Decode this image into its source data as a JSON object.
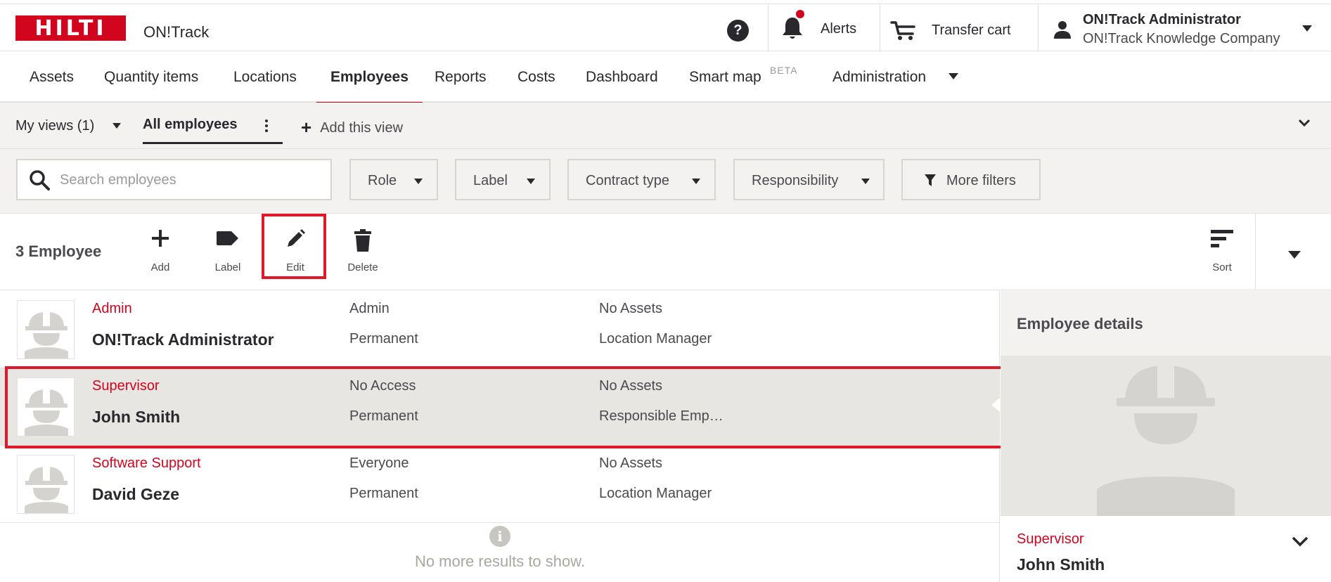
{
  "header": {
    "logo_text": "HILTI",
    "app_name": "ON!Track",
    "help_label": "?",
    "alerts_label": "Alerts",
    "transfer_cart_label": "Transfer cart",
    "user_name": "ON!Track Administrator",
    "user_company": "ON!Track Knowledge Company",
    "brand_color": "#d2051e"
  },
  "nav": {
    "items": [
      {
        "label": "Assets"
      },
      {
        "label": "Quantity items"
      },
      {
        "label": "Locations"
      },
      {
        "label": "Employees",
        "active": true
      },
      {
        "label": "Reports"
      },
      {
        "label": "Costs"
      },
      {
        "label": "Dashboard"
      },
      {
        "label": "Smart map"
      },
      {
        "label": "Administration"
      }
    ],
    "beta_badge": "BETA"
  },
  "views": {
    "my_views_label": "My views",
    "my_views_count": "(1)",
    "current_view": "All employees",
    "add_view_label": "Add this view"
  },
  "filters": {
    "search_placeholder": "Search employees",
    "role_label": "Role",
    "label_label": "Label",
    "contract_type_label": "Contract type",
    "responsibility_label": "Responsibility",
    "more_filters_label": "More filters"
  },
  "toolbar": {
    "count_label": "3 Employee",
    "add_label": "Add",
    "label_label": "Label",
    "edit_label": "Edit",
    "delete_label": "Delete",
    "sort_label": "Sort"
  },
  "employees": [
    {
      "role": "Admin",
      "name": "ON!Track Administrator",
      "access": "Admin",
      "contract": "Permanent",
      "assets": "No Assets",
      "responsibility": "Location Manager"
    },
    {
      "role": "Supervisor",
      "name": "John Smith",
      "access": "No Access",
      "contract": "Permanent",
      "assets": "No Assets",
      "responsibility": "Responsible Emp…",
      "selected": true
    },
    {
      "role": "Software Support",
      "name": "David Geze",
      "access": "Everyone",
      "contract": "Permanent",
      "assets": "No Assets",
      "responsibility": "Location Manager"
    }
  ],
  "list_footer": {
    "info_glyph": "i",
    "text": "No more results to show."
  },
  "details": {
    "title": "Employee details",
    "role": "Supervisor",
    "name": "John Smith"
  }
}
